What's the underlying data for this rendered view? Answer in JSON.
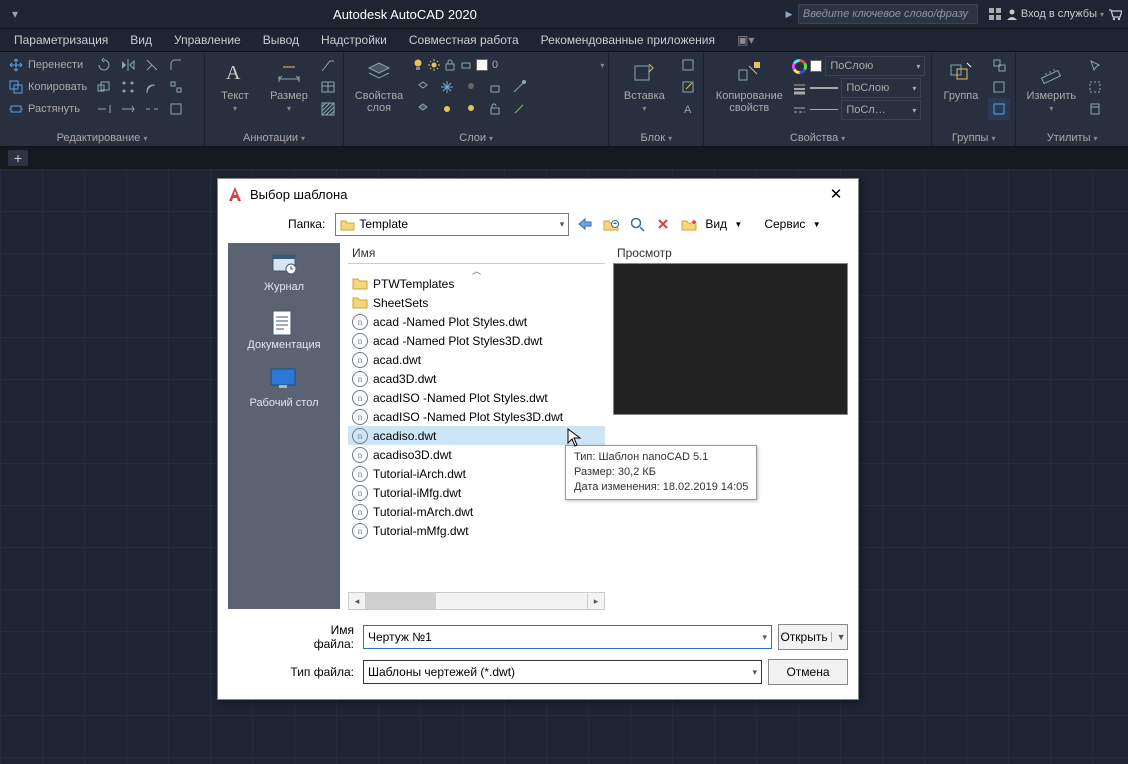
{
  "titlebar": {
    "app_title": "Autodesk AutoCAD 2020",
    "search_placeholder": "Введите ключевое слово/фразу",
    "signin": "Вход в службы"
  },
  "menus": [
    "Параметризация",
    "Вид",
    "Управление",
    "Вывод",
    "Надстройки",
    "Совместная работа",
    "Рекомендованные приложения"
  ],
  "ribbon": {
    "edit": {
      "move": "Перенести",
      "copy": "Копировать",
      "stretch": "Растянуть",
      "title": "Редактирование"
    },
    "annot": {
      "text": "Текст",
      "dim": "Размер",
      "title": "Аннотации"
    },
    "layers": {
      "props": "Свойства слоя",
      "title": "Слои",
      "combo": "ПоСлою",
      "combo2": "ПоСлою",
      "combo3": "ПоСл…"
    },
    "block": {
      "insert": "Вставка",
      "title": "Блок"
    },
    "props": {
      "copyprops": "Копирование свойств",
      "title": "Свойства"
    },
    "groups": {
      "group": "Группа",
      "title": "Группы"
    },
    "util": {
      "measure": "Измерить",
      "title": "Утилиты"
    }
  },
  "dialog": {
    "title": "Выбор шаблона",
    "folder_label": "Папка:",
    "folder_value": "Template",
    "view_label": "Вид",
    "service_label": "Сервис",
    "name_col": "Имя",
    "preview_label": "Просмотр",
    "places": {
      "history": "Журнал",
      "docs": "Документация",
      "desktop": "Рабочий стол"
    },
    "files": [
      {
        "name": "PTWTemplates",
        "type": "folder"
      },
      {
        "name": "SheetSets",
        "type": "folder"
      },
      {
        "name": "acad -Named Plot Styles.dwt",
        "type": "dwt"
      },
      {
        "name": "acad -Named Plot Styles3D.dwt",
        "type": "dwt"
      },
      {
        "name": "acad.dwt",
        "type": "dwt"
      },
      {
        "name": "acad3D.dwt",
        "type": "dwt"
      },
      {
        "name": "acadISO -Named Plot Styles.dwt",
        "type": "dwt"
      },
      {
        "name": "acadISO -Named Plot Styles3D.dwt",
        "type": "dwt"
      },
      {
        "name": "acadiso.dwt",
        "type": "dwt",
        "selected": true
      },
      {
        "name": "acadiso3D.dwt",
        "type": "dwt"
      },
      {
        "name": "Tutorial-iArch.dwt",
        "type": "dwt"
      },
      {
        "name": "Tutorial-iMfg.dwt",
        "type": "dwt"
      },
      {
        "name": "Tutorial-mArch.dwt",
        "type": "dwt"
      },
      {
        "name": "Tutorial-mMfg.dwt",
        "type": "dwt"
      }
    ],
    "tooltip": {
      "l1": "Тип: Шаблон nanoCAD 5.1",
      "l2": "Размер: 30,2 КБ",
      "l3": "Дата изменения: 18.02.2019 14:05"
    },
    "filename_label": "Имя файла:",
    "filename_value": "Чертуж №1",
    "filetype_label": "Тип файла:",
    "filetype_value": "Шаблоны чертежей (*.dwt)",
    "open": "Открыть",
    "cancel": "Отмена"
  }
}
